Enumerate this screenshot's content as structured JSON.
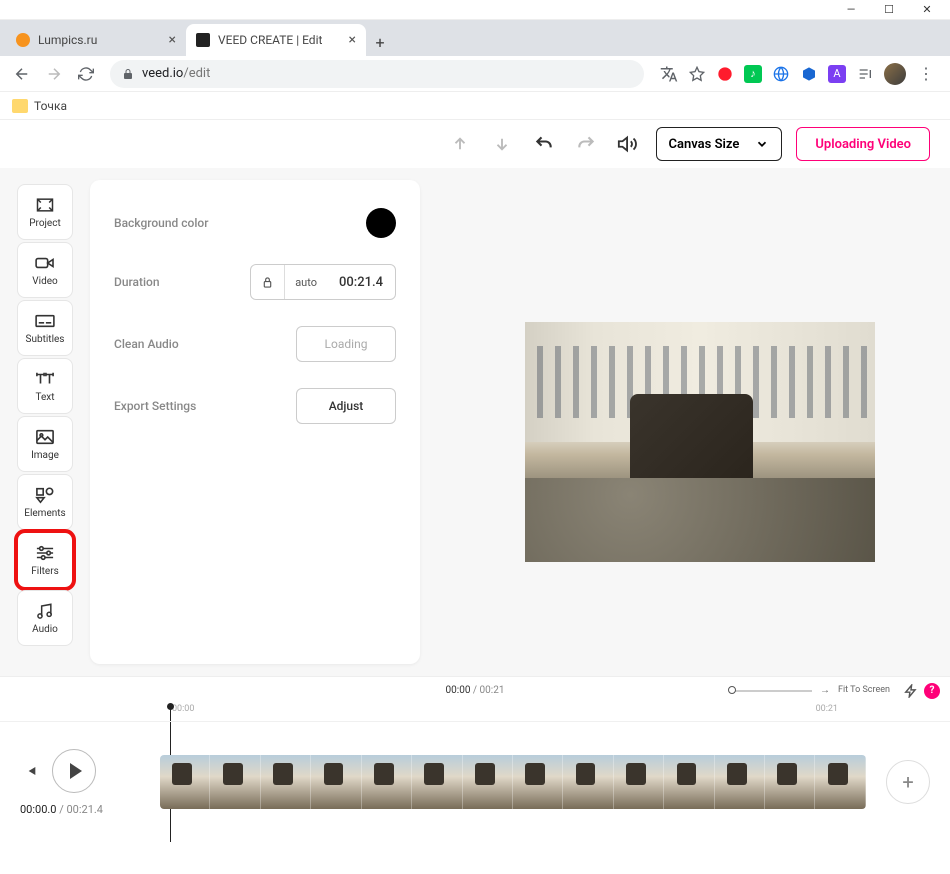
{
  "window": {
    "minimize": "—",
    "maximize": "☐",
    "close": "✕"
  },
  "tabs": [
    {
      "title": "Lumpics.ru",
      "favicon_color": "#f7931e"
    },
    {
      "title": "VEED CREATE | Edit",
      "favicon_color": "#222"
    }
  ],
  "newtab": "+",
  "address": {
    "host": "veed.io",
    "path": "/edit"
  },
  "bookmarks": [
    {
      "label": "Точка"
    }
  ],
  "toolbar": {
    "canvas_size_label": "Canvas Size",
    "upload_label": "Uploading Video"
  },
  "sidebar": {
    "items": [
      {
        "label": "Project",
        "icon": "project"
      },
      {
        "label": "Video",
        "icon": "video"
      },
      {
        "label": "Subtitles",
        "icon": "subtitles"
      },
      {
        "label": "Text",
        "icon": "text"
      },
      {
        "label": "Image",
        "icon": "image"
      },
      {
        "label": "Elements",
        "icon": "elements"
      },
      {
        "label": "Filters",
        "icon": "filters",
        "highlighted": true
      },
      {
        "label": "Audio",
        "icon": "audio"
      }
    ]
  },
  "settings": {
    "bg_label": "Background color",
    "bg_color": "#000000",
    "duration_label": "Duration",
    "duration_auto": "auto",
    "duration_value": "00:21.4",
    "clean_audio_label": "Clean Audio",
    "clean_audio_btn": "Loading",
    "export_label": "Export Settings",
    "export_btn": "Adjust"
  },
  "timeline_info": {
    "current": "00:00",
    "total": "00:21",
    "fit_label": "Fit To Screen",
    "help": "?"
  },
  "ruler": {
    "tick_start": "00:00",
    "tick_end": "00:21"
  },
  "playback": {
    "current": "00:00.0",
    "total": "00:21.4"
  },
  "add_track": "+"
}
